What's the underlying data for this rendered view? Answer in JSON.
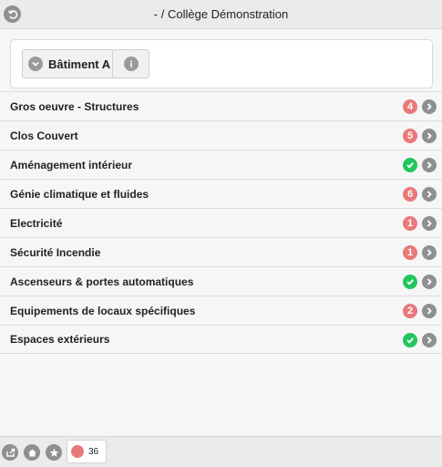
{
  "header": {
    "title": "- / Collège Démonstration",
    "back_icon": "back-icon"
  },
  "building": {
    "label": "Bâtiment A",
    "dropdown_icon": "chevron-down-icon",
    "info_icon": "info-icon"
  },
  "categories": [
    {
      "label": "Gros oeuvre - Structures",
      "status": "count",
      "count": "4"
    },
    {
      "label": "Clos Couvert",
      "status": "count",
      "count": "5"
    },
    {
      "label": "Aménagement intérieur",
      "status": "ok",
      "count": ""
    },
    {
      "label": "Génie climatique et fluides",
      "status": "count",
      "count": "6"
    },
    {
      "label": "Electricité",
      "status": "count",
      "count": "1"
    },
    {
      "label": "Sécurité Incendie",
      "status": "count",
      "count": "1"
    },
    {
      "label": "Ascenseurs & portes automatiques",
      "status": "ok",
      "count": ""
    },
    {
      "label": "Equipements de locaux spécifiques",
      "status": "count",
      "count": "2"
    },
    {
      "label": "Espaces extérieurs",
      "status": "ok",
      "count": ""
    }
  ],
  "colors": {
    "alert": "#e8797a",
    "ok": "#22c55e",
    "icon_gray": "#8f8f8f"
  },
  "footer": {
    "counter_value": "36",
    "icons": [
      "share-icon",
      "home-icon",
      "star-icon"
    ]
  }
}
